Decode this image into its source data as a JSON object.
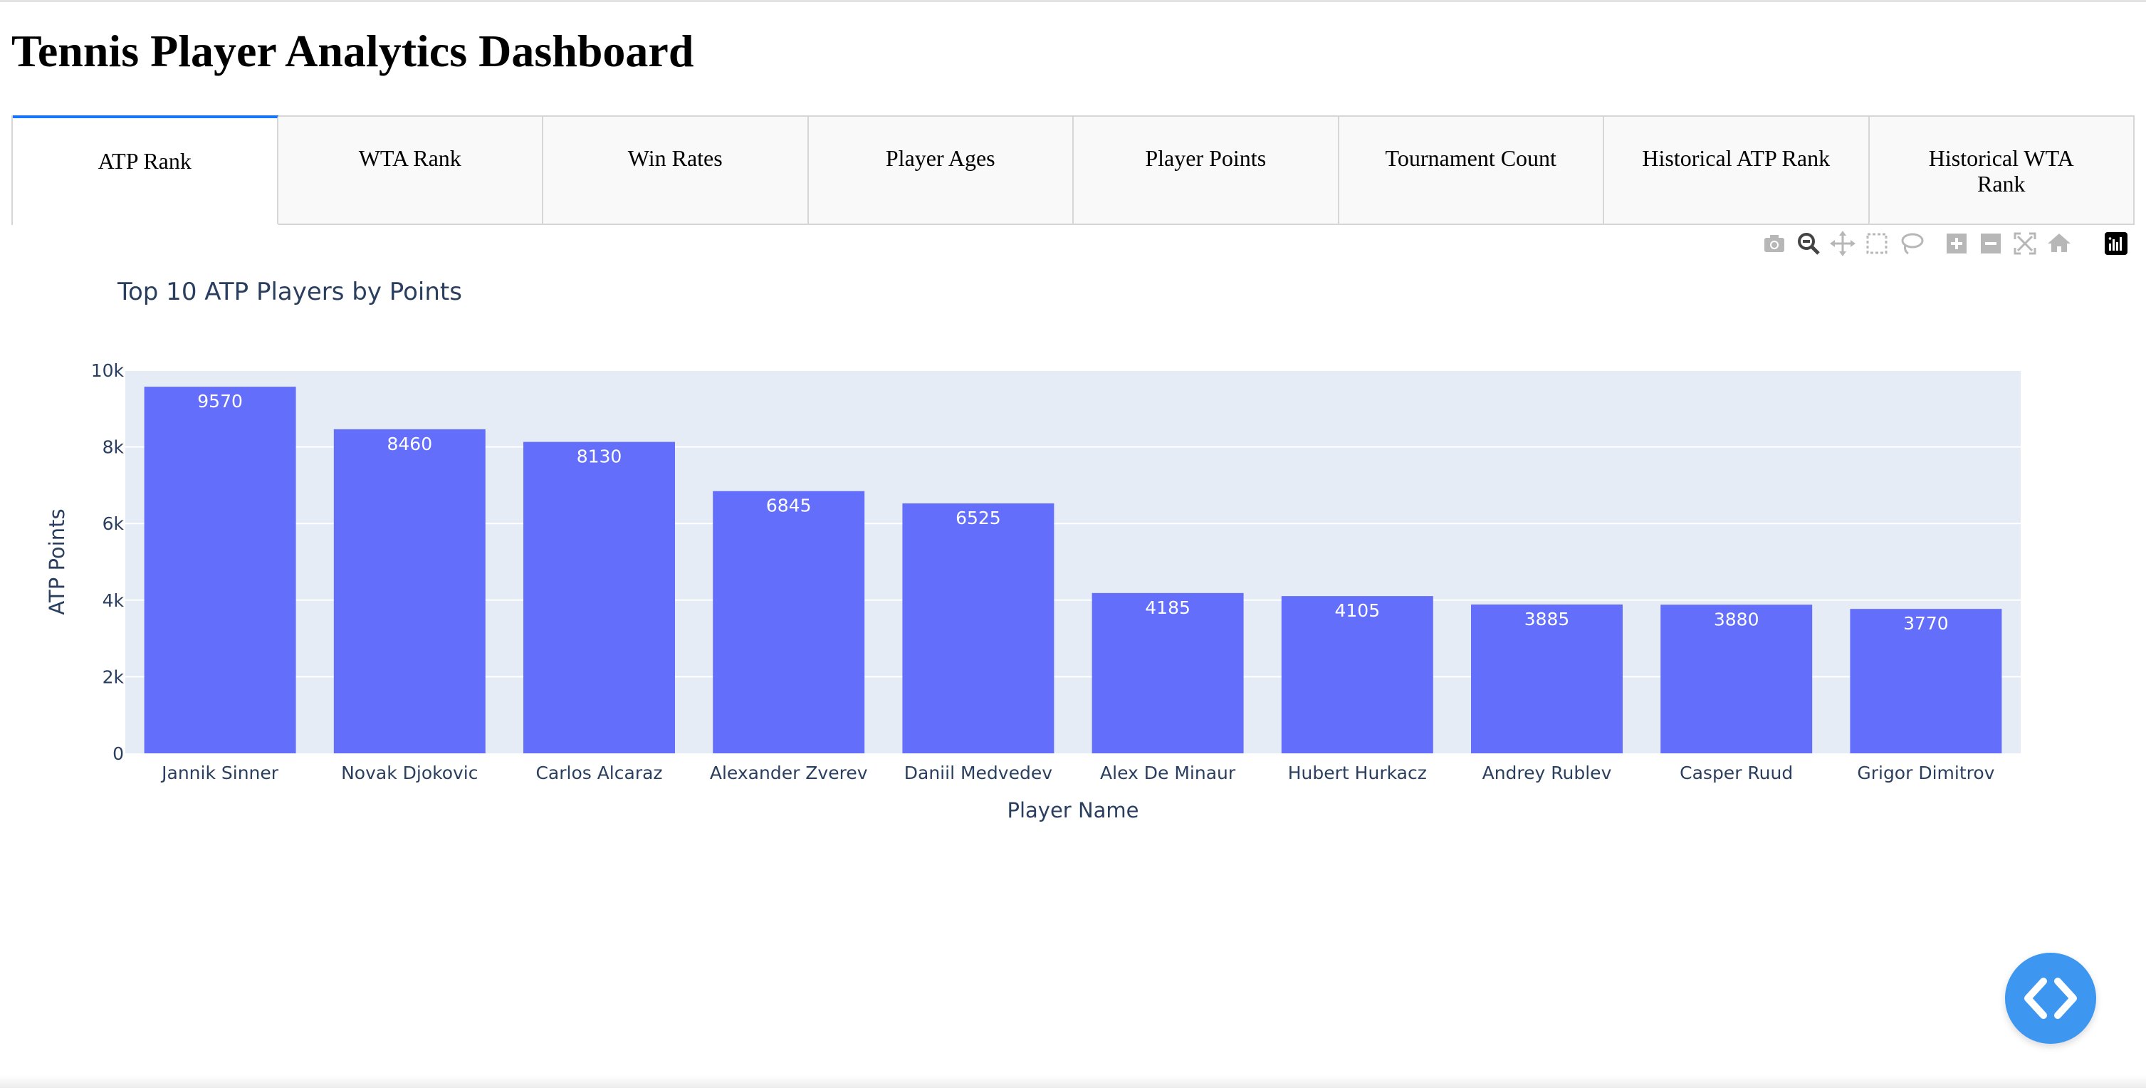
{
  "page": {
    "title": "Tennis Player Analytics Dashboard"
  },
  "tabs": [
    {
      "label": "ATP Rank",
      "selected": true
    },
    {
      "label": "WTA Rank",
      "selected": false
    },
    {
      "label": "Win Rates",
      "selected": false
    },
    {
      "label": "Player Ages",
      "selected": false
    },
    {
      "label": "Player Points",
      "selected": false
    },
    {
      "label": "Tournament Count",
      "selected": false
    },
    {
      "label": "Historical ATP Rank",
      "selected": false
    },
    {
      "label": "Historical WTA Rank",
      "selected": false
    }
  ],
  "modebar": {
    "icons": [
      "camera-icon",
      "zoom-icon",
      "pan-icon",
      "box-select-icon",
      "lasso-icon",
      "zoom-in-icon",
      "zoom-out-icon",
      "autoscale-icon",
      "home-icon",
      "plotly-logo-icon"
    ]
  },
  "colors": {
    "bar": "#636efa",
    "plot_bg": "#e5ecf6",
    "text": "#2a3f5f",
    "accent_tab": "#1975fa",
    "fab": "#3d96f0"
  },
  "chart_data": {
    "type": "bar",
    "title": "Top 10 ATP Players by Points",
    "xlabel": "Player Name",
    "ylabel": "ATP Points",
    "categories": [
      "Jannik Sinner",
      "Novak Djokovic",
      "Carlos Alcaraz",
      "Alexander Zverev",
      "Daniil Medvedev",
      "Alex De Minaur",
      "Hubert Hurkacz",
      "Andrey Rublev",
      "Casper Ruud",
      "Grigor Dimitrov"
    ],
    "values": [
      9570,
      8460,
      8130,
      6845,
      6525,
      4185,
      4105,
      3885,
      3880,
      3770
    ],
    "ylim": [
      0,
      10000
    ],
    "yticks": [
      0,
      2000,
      4000,
      6000,
      8000,
      10000
    ],
    "ytick_labels": [
      "0",
      "2k",
      "4k",
      "6k",
      "8k",
      "10k"
    ],
    "grid": true,
    "show_data_labels": true
  }
}
